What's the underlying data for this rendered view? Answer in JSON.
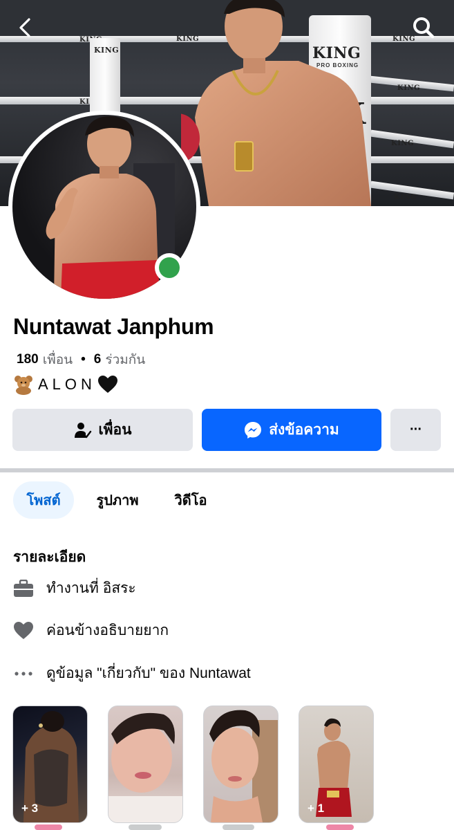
{
  "profile": {
    "name": "Nuntawat Janphum",
    "friends_count": "180",
    "friends_label": "เพื่อน",
    "mutual_count": "6",
    "mutual_label": "ร่วมกัน",
    "bio": "ALON"
  },
  "cover": {
    "ring_brand": "KING",
    "ring_brand_sub": "PRO BOXING"
  },
  "actions": {
    "friend_label": "เพื่อน",
    "message_label": "ส่งข้อความ",
    "more_label": "···"
  },
  "tabs": [
    {
      "label": "โพสต์",
      "active": true
    },
    {
      "label": "รูปภาพ",
      "active": false
    },
    {
      "label": "วิดีโอ",
      "active": false
    }
  ],
  "details": {
    "title": "รายละเอียด",
    "work": "ทำงานที่ อิสระ",
    "relationship": "ค่อนข้างอธิบายยาก",
    "about_link": "ดูข้อมูล \"เกี่ยวกับ\" ของ Nuntawat"
  },
  "featured": [
    {
      "count": "+ 3"
    },
    {
      "count": ""
    },
    {
      "count": ""
    },
    {
      "count": "+ 1"
    }
  ],
  "colors": {
    "accent": "#0866ff",
    "online": "#31a24c",
    "tab_active_bg": "#ebf5ff",
    "tab_active_text": "#0064d1"
  }
}
